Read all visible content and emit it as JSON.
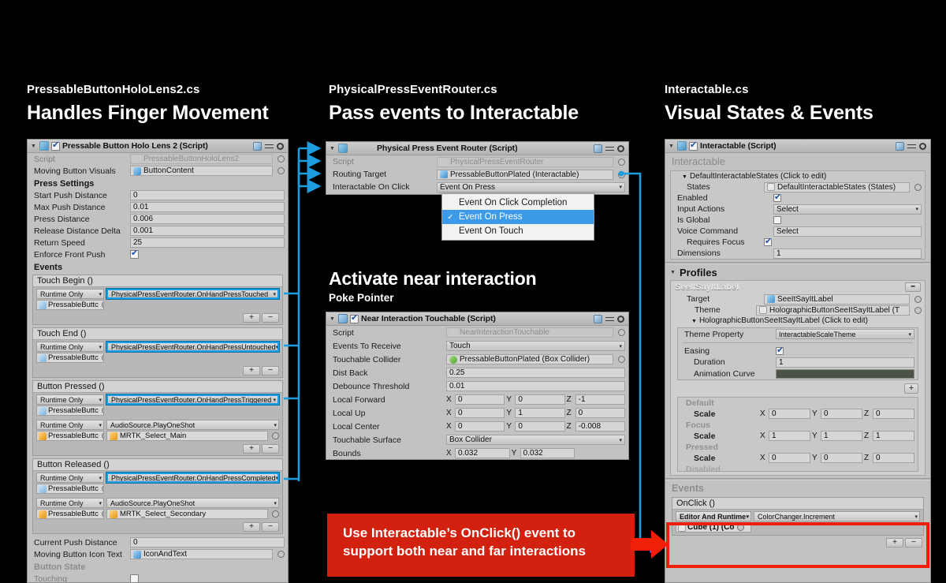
{
  "columns": {
    "left": {
      "script": "PressableButtonHoloLens2.cs",
      "title": "Handles Finger Movement"
    },
    "middle": {
      "script": "PhysicalPressEventRouter.cs",
      "title": "Pass events to Interactable"
    },
    "right": {
      "script": "Interactable.cs",
      "title": "Visual States & Events"
    }
  },
  "middle_section": {
    "title": "Activate near interaction",
    "subtitle": "Poke Pointer"
  },
  "callout": {
    "line1": "Use Interactable’s OnClick() event to",
    "line2": "support both near and far interactions",
    "color": "#d32110"
  },
  "accent": {
    "highlight_blue": "#199fe0",
    "selection_blue": "#3d9ae8",
    "red_outline": "#ef1f08"
  },
  "pressable_button": {
    "header": "Pressable Button Holo Lens 2 (Script)",
    "enabled": true,
    "rows": [
      {
        "label": "Script",
        "value": "PressableButtonHoloLens2",
        "type": "object-disabled",
        "icon": "script-icon"
      },
      {
        "label": "Moving Button Visuals",
        "value": "ButtonContent",
        "type": "object",
        "icon": "transform-icon"
      }
    ],
    "press_settings_label": "Press Settings",
    "press_settings": [
      {
        "label": "Start Push Distance",
        "value": "0"
      },
      {
        "label": "Max Push Distance",
        "value": "0.01"
      },
      {
        "label": "Press Distance",
        "value": "0.006"
      },
      {
        "label": "Release Distance Delta",
        "value": "0.001"
      },
      {
        "label": "Return Speed",
        "value": "25"
      }
    ],
    "enforce_front_push": {
      "label": "Enforce Front Push",
      "checked": true
    },
    "events_label": "Events",
    "events": [
      {
        "title": "Touch Begin ()",
        "entries": [
          {
            "mode": "Runtime Only",
            "function": "PhysicalPressEventRouter.OnHandPressTouched",
            "highlight": true,
            "object": "PressableButtc",
            "object_icon": "prefab-icon",
            "arg": null
          }
        ]
      },
      {
        "title": "Touch End ()",
        "entries": [
          {
            "mode": "Runtime Only",
            "function": "PhysicalPressEventRouter.OnHandPressUntouched",
            "highlight": true,
            "object": "PressableButtc",
            "object_icon": "prefab-icon",
            "arg": null
          }
        ]
      },
      {
        "title": "Button Pressed ()",
        "entries": [
          {
            "mode": "Runtime Only",
            "function": "PhysicalPressEventRouter.OnHandPressTriggered",
            "highlight": true,
            "object": "PressableButtc",
            "object_icon": "prefab-icon",
            "arg": null
          },
          {
            "mode": "Runtime Only",
            "function": "AudioSource.PlayOneShot",
            "highlight": false,
            "object": "PressableButtc",
            "object_icon": "audio-icon",
            "arg": "MRTK_Select_Main"
          }
        ]
      },
      {
        "title": "Button Released ()",
        "entries": [
          {
            "mode": "Runtime Only",
            "function": "PhysicalPressEventRouter.OnHandPressCompleted",
            "highlight": true,
            "object": "PressableButtc",
            "object_icon": "prefab-icon",
            "arg": null
          },
          {
            "mode": "Runtime Only",
            "function": "AudioSource.PlayOneShot",
            "highlight": false,
            "object": "PressableButtc",
            "object_icon": "audio-icon",
            "arg": "MRTK_Select_Secondary"
          }
        ]
      }
    ],
    "footer_rows": [
      {
        "label": "Current Push Distance",
        "value": "0",
        "type": "text"
      },
      {
        "label": "Moving Button Icon Text",
        "value": "IconAndText",
        "type": "object",
        "icon": "transform-icon"
      }
    ],
    "button_state_label": "Button State",
    "touching_label": "Touching"
  },
  "press_router": {
    "header": "Physical Press Event Router (Script)",
    "rows": [
      {
        "label": "Script",
        "value": "PhysicalPressEventRouter",
        "type": "object-disabled"
      },
      {
        "label": "Routing Target",
        "value": "PressableButtonPlated (Interactable)",
        "type": "object"
      },
      {
        "label": "Interactable On Click",
        "value": "Event On Press",
        "type": "popup"
      }
    ],
    "dropdown": {
      "open": true,
      "options": [
        {
          "label": "Event On Click Completion",
          "selected": false
        },
        {
          "label": "Event On Press",
          "selected": true
        },
        {
          "label": "Event On Touch",
          "selected": false
        }
      ]
    }
  },
  "near_touchable": {
    "header": "Near Interaction Touchable (Script)",
    "enabled": true,
    "rows": [
      {
        "label": "Script",
        "value": "NearInteractionTouchable",
        "type": "object-disabled"
      },
      {
        "label": "Events To Receive",
        "value": "Touch",
        "type": "popup"
      },
      {
        "label": "Touchable Collider",
        "value": "PressableButtonPlated (Box Collider)",
        "type": "object-green"
      },
      {
        "label": "Dist Back",
        "value": "0.25",
        "type": "text"
      },
      {
        "label": "Debounce Threshold",
        "value": "0.01",
        "type": "text"
      }
    ],
    "vectors": [
      {
        "label": "Local Forward",
        "x": "0",
        "y": "0",
        "z": "-1"
      },
      {
        "label": "Local Up",
        "x": "0",
        "y": "1",
        "z": "0"
      },
      {
        "label": "Local Center",
        "x": "0",
        "y": "0",
        "z": "-0.008"
      }
    ],
    "surface": {
      "label": "Touchable Surface",
      "value": "Box Collider"
    },
    "bounds": {
      "label": "Bounds",
      "x": "0.032",
      "y": "0.032"
    }
  },
  "interactable": {
    "header": "Interactable (Script)",
    "enabled": true,
    "section_label": "Interactable",
    "states_foldout": "DefaultInteractableStates (Click to edit)",
    "rows": [
      {
        "label": "States",
        "value": "DefaultInteractableStates (States)",
        "type": "object"
      },
      {
        "label": "Enabled",
        "value": "",
        "type": "checkbox",
        "checked": true
      },
      {
        "label": "Input Actions",
        "value": "Select",
        "type": "popup"
      },
      {
        "label": "Is Global",
        "value": "",
        "type": "checkbox",
        "checked": false
      },
      {
        "label": "Voice Command",
        "value": "Select",
        "type": "text"
      },
      {
        "label": "Requires Focus",
        "value": "",
        "type": "checkbox",
        "checked": true,
        "indent": true
      },
      {
        "label": "Dimensions",
        "value": "1",
        "type": "text"
      }
    ],
    "profiles_label": "Profiles",
    "profile": {
      "name": "SeeItSayItLabel",
      "target": {
        "label": "Target",
        "value": "SeeItSayItLabel"
      },
      "theme": {
        "label": "Theme",
        "value": "HolographicButtonSeeItSayItLabel (T"
      },
      "theme_foldout": "HolographicButtonSeeItSayItLabel (Click to edit)",
      "theme_property": {
        "label": "Theme Property",
        "value": "InteractableScaleTheme"
      },
      "easing": {
        "label": "Easing",
        "checked": true
      },
      "duration": {
        "label": "Duration",
        "value": "1"
      },
      "animation_curve": {
        "label": "Animation Curve",
        "value": ""
      },
      "states": [
        {
          "name": "Default",
          "label": "Scale",
          "x": "0",
          "y": "0",
          "z": "0"
        },
        {
          "name": "Focus",
          "label": "Scale",
          "x": "1",
          "y": "1",
          "z": "1"
        },
        {
          "name": "Pressed",
          "label": "Scale",
          "x": "0",
          "y": "0",
          "z": "0"
        },
        {
          "name": "Disabled",
          "label": "",
          "x": "",
          "y": "",
          "z": ""
        }
      ]
    },
    "events_label": "Events",
    "onclick": {
      "title": "OnClick ()",
      "mode": "Editor And Runtime",
      "function": "ColorChanger.Increment",
      "object": "Cube (1) (Co"
    }
  }
}
